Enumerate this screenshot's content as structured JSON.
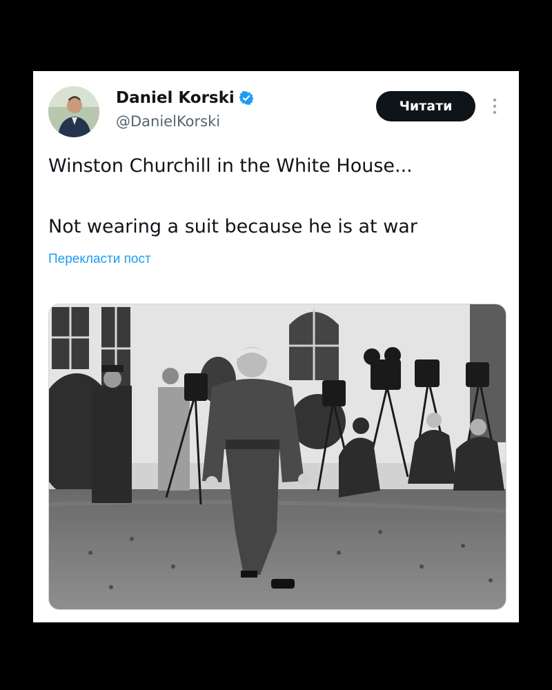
{
  "post": {
    "author_name": "Daniel Korski",
    "author_handle": "@DanielKorski",
    "follow_label": "Читати",
    "text_line_1": "Winston Churchill in the White House...",
    "text_line_2": "Not wearing a suit because he is at war",
    "translate_label": "Перекласти пост"
  },
  "icons": {
    "verified": "verified-badge-icon",
    "more": "more-vertical-icon"
  },
  "colors": {
    "background": "#000000",
    "card": "#ffffff",
    "accent": "#1d9bf0",
    "button": "#0f1419"
  }
}
